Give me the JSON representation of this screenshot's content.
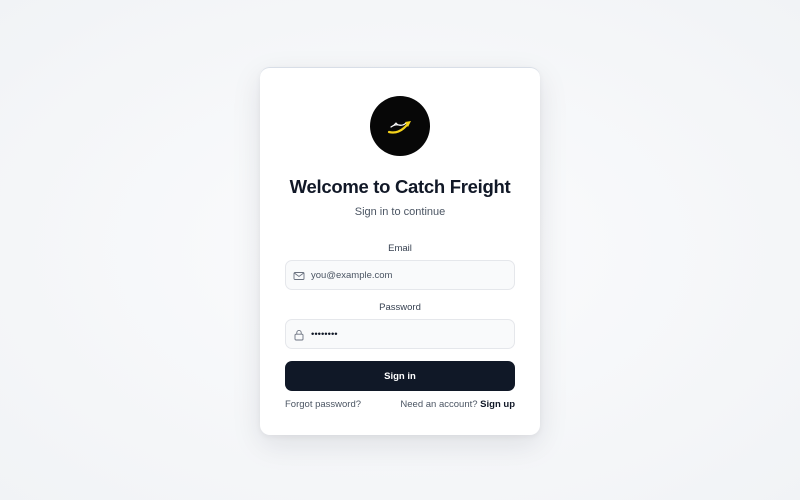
{
  "login": {
    "title": "Welcome to Catch Freight",
    "subtitle": "Sign in to continue",
    "email": {
      "label": "Email",
      "placeholder": "you@example.com",
      "value": ""
    },
    "password": {
      "label": "Password",
      "value": "********"
    },
    "signin_label": "Sign in",
    "forgot_label": "Forgot password?",
    "signup_prompt": "Need an account?",
    "signup_label": "Sign up"
  },
  "icons": {
    "logo": "catch-freight-logo",
    "email": "mail-icon",
    "password": "lock-icon"
  },
  "colors": {
    "primary": "#101827",
    "logo_bg": "#070707",
    "logo_accent": "#f5d21a",
    "text_muted": "#4b5563"
  }
}
